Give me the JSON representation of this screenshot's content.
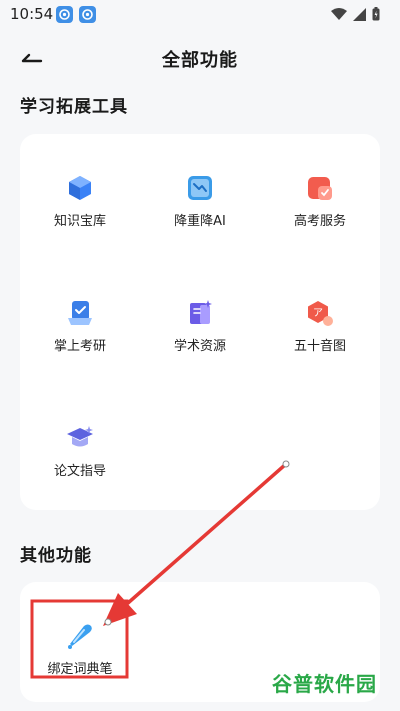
{
  "status_bar": {
    "time": "10:54"
  },
  "header": {
    "title": "全部功能"
  },
  "sections": [
    {
      "title": "学习拓展工具",
      "tiles": [
        {
          "label": "知识宝库",
          "icon": "knowledge-cube-icon",
          "color": "#3b82f6"
        },
        {
          "label": "降重降AI",
          "icon": "trend-down-icon",
          "color": "#3a9be8"
        },
        {
          "label": "高考服务",
          "icon": "exam-service-icon",
          "color": "#f25c4e"
        },
        {
          "label": "掌上考研",
          "icon": "postgrad-check-icon",
          "color": "#3b7fe8"
        },
        {
          "label": "学术资源",
          "icon": "academic-book-icon",
          "color": "#6b5ce7"
        },
        {
          "label": "五十音图",
          "icon": "kana-chart-icon",
          "color": "#f05a4a"
        },
        {
          "label": "论文指导",
          "icon": "graduation-cap-icon",
          "color": "#5d63df"
        }
      ]
    },
    {
      "title": "其他功能",
      "tiles": [
        {
          "label": "绑定词典笔",
          "icon": "dictionary-pen-icon",
          "color": "#3aa0f0"
        }
      ]
    }
  ],
  "watermark": {
    "text": "谷普软件园"
  },
  "annotation": {
    "color": "#e53935"
  }
}
